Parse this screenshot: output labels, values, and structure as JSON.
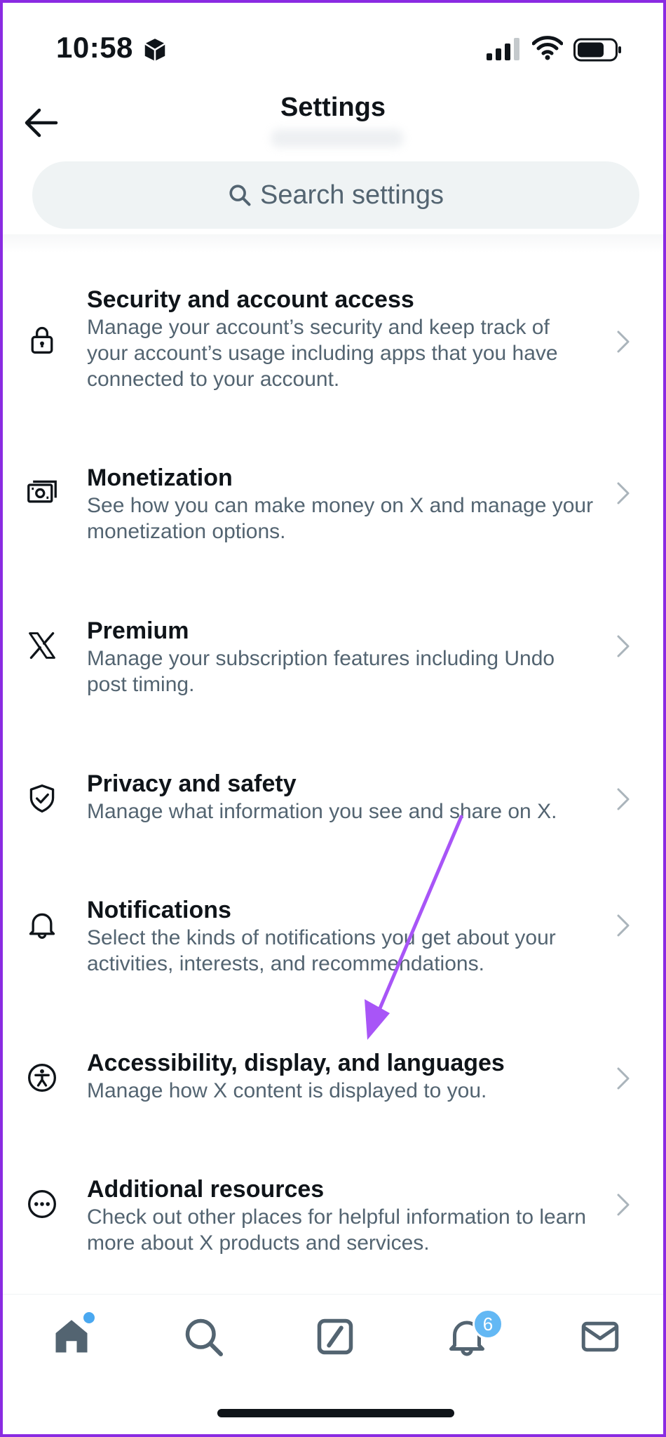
{
  "status_bar": {
    "time": "10:58"
  },
  "header": {
    "title": "Settings",
    "back_icon": "arrow-left-icon"
  },
  "search": {
    "placeholder": "Search settings",
    "icon": "search-icon"
  },
  "settings": [
    {
      "title": "Security and account access",
      "description": "Manage your account’s security and keep track of your account’s usage including apps that you have connected to your account.",
      "icon": "lock-icon"
    },
    {
      "title": "Monetization",
      "description": "See how you can make money on X and manage your monetization options.",
      "icon": "money-icon"
    },
    {
      "title": "Premium",
      "description": "Manage your subscription features including Undo post timing.",
      "icon": "x-logo-icon"
    },
    {
      "title": "Privacy and safety",
      "description": "Manage what information you see and share on X.",
      "icon": "shield-icon"
    },
    {
      "title": "Notifications",
      "description": "Select the kinds of notifications you get about your activities, interests, and recommendations.",
      "icon": "bell-icon"
    },
    {
      "title": "Accessibility, display, and languages",
      "description": "Manage how X content is displayed to you.",
      "icon": "accessibility-icon"
    },
    {
      "title": "Additional resources",
      "description": "Check out other places for helpful information to learn more about X products and services.",
      "icon": "more-icon"
    }
  ],
  "tab_bar": {
    "tabs": [
      "home-icon",
      "search-icon",
      "grok-icon",
      "notifications-icon",
      "messages-icon"
    ],
    "notification_badge": "6"
  },
  "colors": {
    "accent": "#1d9bf0",
    "annotation": "#a855f7",
    "frame": "#8a2be2"
  }
}
